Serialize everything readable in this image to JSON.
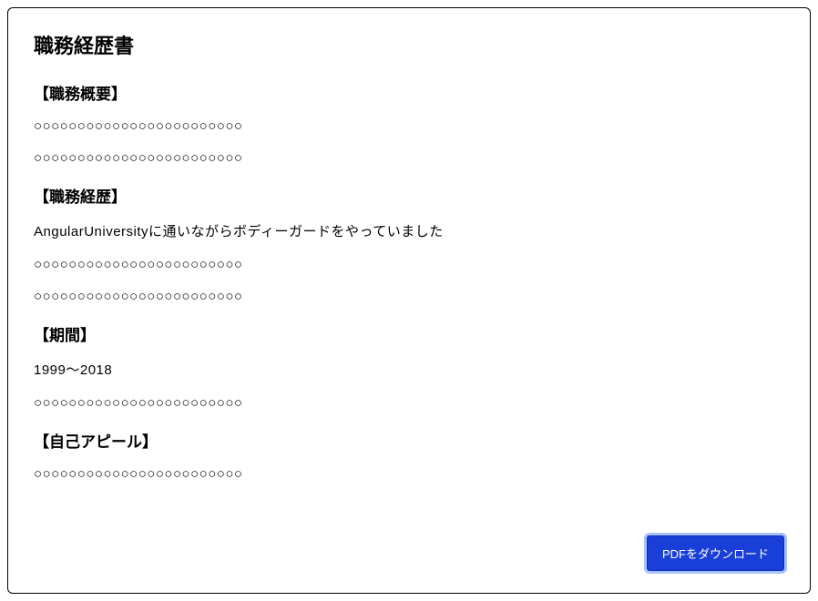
{
  "title": "職務経歴書",
  "sections": {
    "overview": {
      "heading": "【職務概要】",
      "lines": [
        "○○○○○○○○○○○○○○○○○○○○○○○○",
        "○○○○○○○○○○○○○○○○○○○○○○○○"
      ]
    },
    "history": {
      "heading": "【職務経歴】",
      "lines": [
        "AngularUniversityに通いながらボディーガードをやっていました",
        "○○○○○○○○○○○○○○○○○○○○○○○○",
        "○○○○○○○○○○○○○○○○○○○○○○○○"
      ]
    },
    "period": {
      "heading": "【期間】",
      "lines": [
        "1999〜2018",
        "○○○○○○○○○○○○○○○○○○○○○○○○"
      ]
    },
    "appeal": {
      "heading": "【自己アピール】",
      "lines": [
        "○○○○○○○○○○○○○○○○○○○○○○○○"
      ]
    }
  },
  "button": {
    "download_label": "PDFをダウンロード"
  }
}
